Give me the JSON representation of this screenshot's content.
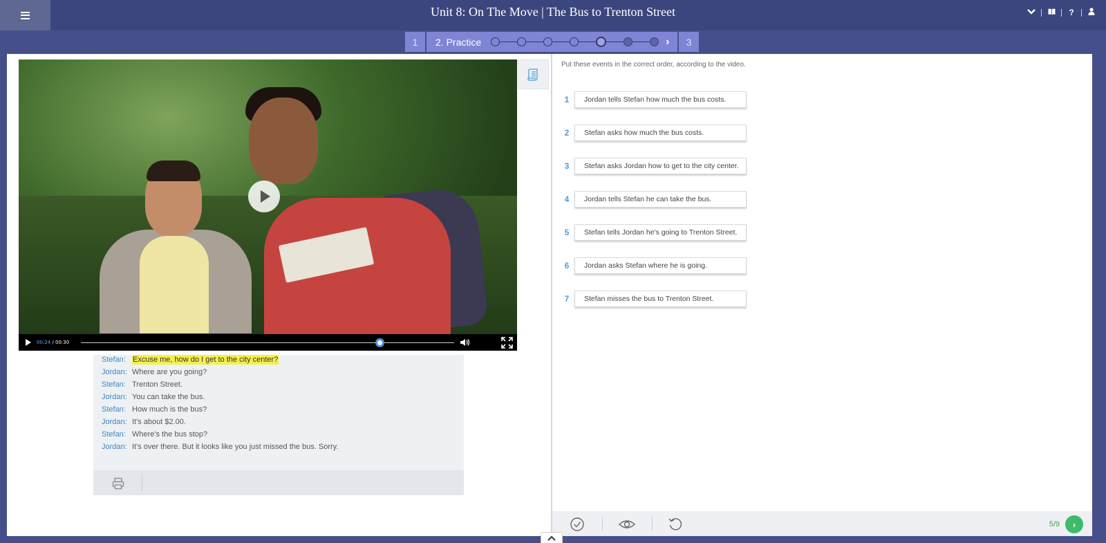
{
  "header": {
    "title": "Unit 8: On The Move | The Bus to Trenton Street",
    "menu_icon": "hamburger-icon",
    "icons": [
      "chevron-down-icon",
      "book-icon",
      "help-icon",
      "user-icon"
    ],
    "help_glyph": "?"
  },
  "steps": {
    "prev": "1",
    "active": "2. Practice",
    "next": "3",
    "progress": {
      "total_dots": 7,
      "current_index": 5
    }
  },
  "video": {
    "current_time": "00:24",
    "duration": "00:30",
    "progress_fraction": 0.8,
    "time_separator": " / "
  },
  "transcript": {
    "lines": [
      {
        "speaker": "Stefan:",
        "text": "Excuse me, how do I get to the city center?",
        "highlighted": true
      },
      {
        "speaker": "Jordan:",
        "text": "Where are you going?"
      },
      {
        "speaker": "Stefan:",
        "text": "Trenton Street."
      },
      {
        "speaker": "Jordan:",
        "text": "You can take the bus."
      },
      {
        "speaker": "Stefan:",
        "text": "How much is the bus?"
      },
      {
        "speaker": "Jordan:",
        "text": "It's about $2.00."
      },
      {
        "speaker": "Stefan:",
        "text": "Where's the bus stop?"
      },
      {
        "speaker": "Jordan:",
        "text": "It's over there. But it looks like you just missed the bus. Sorry."
      }
    ]
  },
  "exercise": {
    "instructions": "Put these events in the correct order, according to the video.",
    "items": [
      {
        "num": "1",
        "text": "Jordan tells Stefan how much the bus costs."
      },
      {
        "num": "2",
        "text": "Stefan asks how much the bus costs."
      },
      {
        "num": "3",
        "text": "Stefan asks Jordan how to get to the city center."
      },
      {
        "num": "4",
        "text": "Jordan tells Stefan he can take the bus."
      },
      {
        "num": "5",
        "text": "Stefan tells Jordan he's going to Trenton Street."
      },
      {
        "num": "6",
        "text": "Jordan asks Stefan where he is going."
      },
      {
        "num": "7",
        "text": "Stefan misses the bus to Trenton Street."
      }
    ]
  },
  "footer": {
    "page_count": "5/9",
    "tools": [
      "check-icon",
      "eye-icon",
      "reset-icon"
    ]
  },
  "colors": {
    "header_bg": "#3c467e",
    "step_bg": "#7f85d4",
    "accent_blue": "#4a9fd8",
    "highlight": "#f5f049",
    "next_green": "#3dbb6a"
  }
}
